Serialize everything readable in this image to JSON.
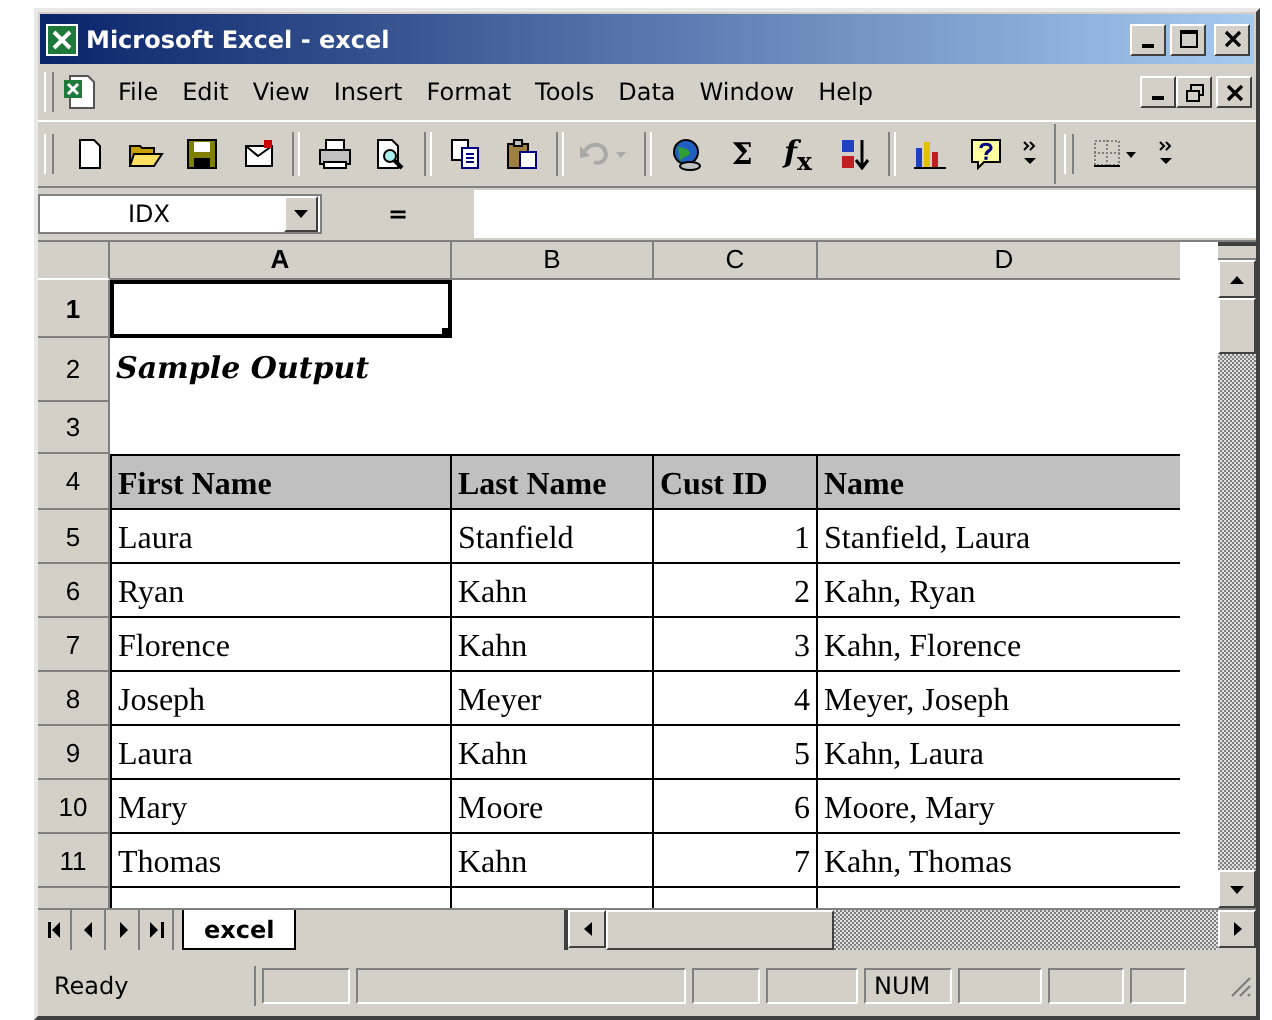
{
  "window": {
    "title": "Microsoft Excel - excel"
  },
  "menu": [
    {
      "label": "File"
    },
    {
      "label": "Edit"
    },
    {
      "label": "View"
    },
    {
      "label": "Insert"
    },
    {
      "label": "Format"
    },
    {
      "label": "Tools"
    },
    {
      "label": "Data"
    },
    {
      "label": "Window"
    },
    {
      "label": "Help"
    }
  ],
  "toolbar": [
    {
      "kind": "new"
    },
    {
      "kind": "open"
    },
    {
      "kind": "save"
    },
    {
      "kind": "mail"
    },
    {
      "kind": "separator"
    },
    {
      "kind": "print"
    },
    {
      "kind": "preview"
    },
    {
      "kind": "separator"
    },
    {
      "kind": "copy"
    },
    {
      "kind": "paste"
    },
    {
      "kind": "separator"
    },
    {
      "kind": "undo",
      "disabled": true
    },
    {
      "kind": "separator"
    },
    {
      "kind": "globe"
    },
    {
      "kind": "glyph",
      "text": "Σ"
    },
    {
      "kind": "glyph",
      "text": "*f*$_{x}$"
    },
    {
      "kind": "sort"
    },
    {
      "kind": "separator"
    },
    {
      "kind": "chart"
    },
    {
      "kind": "help"
    },
    {
      "kind": "more"
    },
    {
      "kind": "bar"
    },
    {
      "kind": "borders"
    },
    {
      "kind": "more"
    }
  ],
  "formula_bar": {
    "name_box": "IDX",
    "equals": "="
  },
  "sheet": {
    "columns": [
      {
        "label": "A",
        "selected": true,
        "kind": "text"
      },
      {
        "label": "B",
        "selected": false,
        "kind": "text"
      },
      {
        "label": "C",
        "selected": false,
        "kind": "number"
      },
      {
        "label": "D",
        "selected": false,
        "kind": "text"
      }
    ],
    "rows": [
      {
        "number": "1",
        "selected": true,
        "kind": "blank"
      },
      {
        "number": "2",
        "selected": false,
        "kind": "title",
        "cells": [
          "Sample Output"
        ]
      },
      {
        "number": "3",
        "selected": false,
        "kind": "blank"
      },
      {
        "number": "4",
        "selected": false,
        "kind": "header",
        "cells": [
          "First Name",
          "Last Name",
          "Cust ID",
          "Name"
        ]
      },
      {
        "number": "5",
        "selected": false,
        "kind": "data",
        "cells": [
          "Laura",
          "Stanfield",
          "1",
          "Stanfield, Laura"
        ]
      },
      {
        "number": "6",
        "selected": false,
        "kind": "data",
        "cells": [
          "Ryan",
          "Kahn",
          "2",
          "Kahn, Ryan"
        ]
      },
      {
        "number": "7",
        "selected": false,
        "kind": "data",
        "cells": [
          "Florence",
          "Kahn",
          "3",
          "Kahn, Florence"
        ]
      },
      {
        "number": "8",
        "selected": false,
        "kind": "data",
        "cells": [
          "Joseph",
          "Meyer",
          "4",
          "Meyer, Joseph"
        ]
      },
      {
        "number": "9",
        "selected": false,
        "kind": "data",
        "cells": [
          "Laura",
          "Kahn",
          "5",
          "Kahn, Laura"
        ]
      },
      {
        "number": "10",
        "selected": false,
        "kind": "data",
        "cells": [
          "Mary",
          "Moore",
          "6",
          "Moore, Mary"
        ]
      },
      {
        "number": "11",
        "selected": false,
        "kind": "data",
        "cells": [
          "Thomas",
          "Kahn",
          "7",
          "Kahn, Thomas"
        ]
      }
    ]
  },
  "sheet_tabs": [
    {
      "label": "excel",
      "selected": true
    }
  ],
  "status_bar": {
    "message": "Ready",
    "indicators": [
      {
        "text": "NUM"
      }
    ]
  }
}
